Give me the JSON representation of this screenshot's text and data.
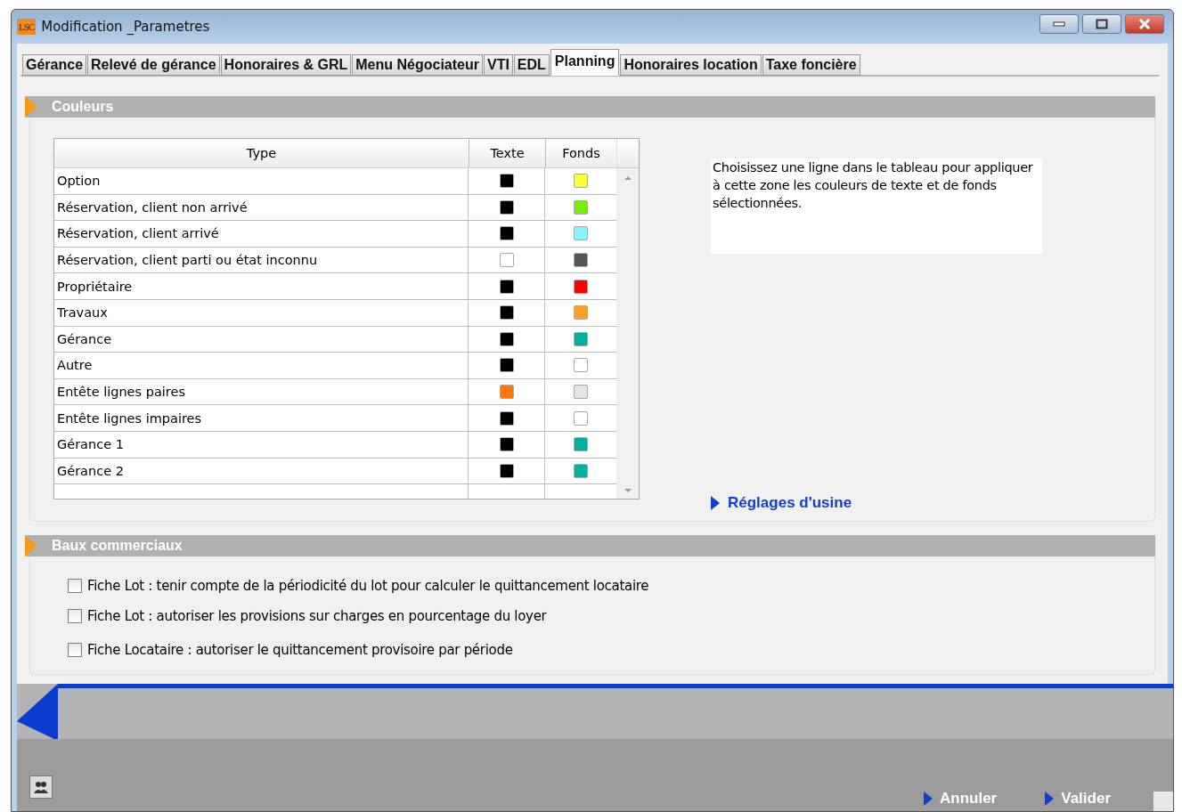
{
  "window": {
    "title": "Modification _Parametres",
    "logo": "LSC"
  },
  "tabs": [
    {
      "label": "Gérance",
      "selected": false
    },
    {
      "label": "Relevé de gérance",
      "selected": false
    },
    {
      "label": "Honoraires & GRL",
      "selected": false
    },
    {
      "label": "Menu Négociateur",
      "selected": false
    },
    {
      "label": "VTI",
      "selected": false
    },
    {
      "label": "EDL",
      "selected": false
    },
    {
      "label": "Planning",
      "selected": true
    },
    {
      "label": "Honoraires location",
      "selected": false
    },
    {
      "label": "Taxe foncière",
      "selected": false
    }
  ],
  "colors_section": {
    "title": "Couleurs",
    "table": {
      "columns": [
        "Type",
        "Texte",
        "Fonds"
      ],
      "rows": [
        {
          "type": "Option",
          "text_swatch": {
            "color": "#000000"
          },
          "fill_swatch": {
            "color": "#ffff33"
          }
        },
        {
          "type": "Réservation, client non arrivé",
          "text_swatch": {
            "color": "#000000"
          },
          "fill_swatch": {
            "color": "#77ee00"
          }
        },
        {
          "type": "Réservation, client arrivé",
          "text_swatch": {
            "color": "#000000"
          },
          "fill_swatch": {
            "color": "#88f4ff"
          }
        },
        {
          "type": "Réservation, client parti ou état inconnu",
          "text_swatch": {
            "color": "#ffffff"
          },
          "fill_swatch": {
            "color": "#555555"
          }
        },
        {
          "type": "Propriétaire",
          "text_swatch": {
            "color": "#000000"
          },
          "fill_swatch": {
            "color": "#ff0000"
          }
        },
        {
          "type": "Travaux",
          "text_swatch": {
            "color": "#000000"
          },
          "fill_swatch": {
            "color": "#ffa020"
          }
        },
        {
          "type": "Gérance",
          "text_swatch": {
            "color": "#000000"
          },
          "fill_swatch": {
            "color": "#00b0a0"
          }
        },
        {
          "type": "Autre",
          "text_swatch": {
            "color": "#000000"
          },
          "fill_swatch": {
            "color": "#ffffff"
          }
        },
        {
          "type": "Entête lignes paires",
          "text_swatch": {
            "color": "#ff7700"
          },
          "fill_swatch": {
            "color": "#e4e4e4"
          }
        },
        {
          "type": "Entête lignes impaires",
          "text_swatch": {
            "color": "#000000"
          },
          "fill_swatch": {
            "color": "#ffffff"
          }
        },
        {
          "type": "Gérance 1",
          "text_swatch": {
            "color": "#000000"
          },
          "fill_swatch": {
            "color": "#00b0a0"
          }
        },
        {
          "type": "Gérance 2",
          "text_swatch": {
            "color": "#000000"
          },
          "fill_swatch": {
            "color": "#00b0a0"
          }
        }
      ]
    },
    "hint": "Choisissez une ligne dans le tableau pour appliquer à cette zone les couleurs de texte et de fonds sélectionnées.",
    "reset_link": "Réglages d'usine"
  },
  "leases_section": {
    "title": "Baux commerciaux",
    "options": [
      {
        "label": "Fiche Lot : tenir compte de la périodicité du lot pour calculer le quittancement locataire",
        "checked": false
      },
      {
        "label": "Fiche Lot : autoriser les provisions sur charges en pourcentage du loyer",
        "checked": false
      },
      {
        "label": "Fiche Locataire : autoriser le quittancement provisoire par période",
        "checked": false
      }
    ]
  },
  "footer": {
    "buttons": [
      "Annuler",
      "Valider"
    ]
  }
}
